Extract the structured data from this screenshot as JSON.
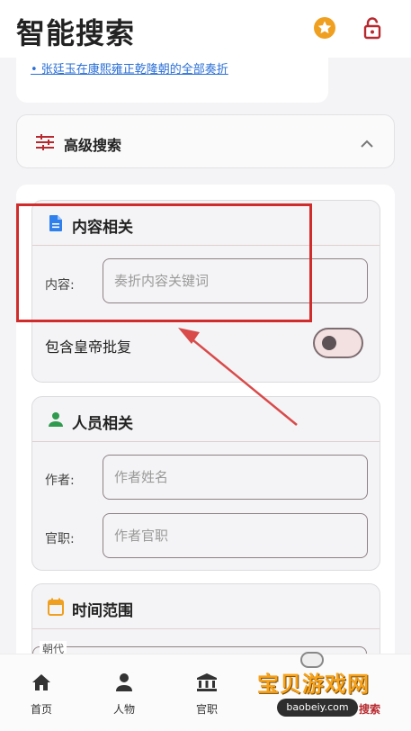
{
  "header": {
    "title": "智能搜索",
    "star_icon": "star-icon",
    "lock_icon": "lock-icon"
  },
  "links": {
    "items": [
      "• 张廷玉在康熙雍正乾隆朝的全部奏折"
    ]
  },
  "advanced": {
    "label": "高级搜索",
    "icon": "sliders-icon",
    "expanded": true
  },
  "sections": {
    "content": {
      "title": "内容相关",
      "icon": "document-icon",
      "icon_color": "#2f80ed",
      "field_label": "内容:",
      "field_placeholder": "奏折内容关键词",
      "field_value": "",
      "toggle_label": "包含皇帝批复",
      "toggle_on": false
    },
    "people": {
      "title": "人员相关",
      "icon": "person-icon",
      "icon_color": "#2e9b4f",
      "author_label": "作者:",
      "author_placeholder": "作者姓名",
      "official_label": "官职:",
      "official_placeholder": "作者官职"
    },
    "time": {
      "title": "时间范围",
      "icon": "calendar-icon",
      "icon_color": "#f0a020",
      "era_label": "朝代"
    }
  },
  "bottom_nav": {
    "items": [
      {
        "label": "首页",
        "icon": "home-icon"
      },
      {
        "label": "人物",
        "icon": "person-icon"
      },
      {
        "label": "官职",
        "icon": "institution-icon"
      },
      {
        "label": "",
        "icon": "hidden-icon"
      },
      {
        "label": "搜索",
        "icon": "search-icon",
        "active": true
      }
    ]
  },
  "watermark": {
    "title": "宝贝游戏网",
    "url": "baobeiy.com"
  },
  "colors": {
    "accent": "#b8292f",
    "annotation": "#d12c2c"
  }
}
